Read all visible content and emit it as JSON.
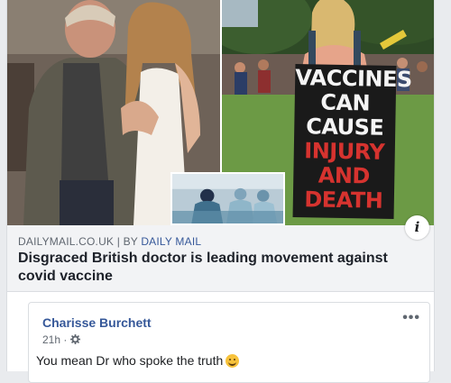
{
  "link_preview": {
    "sign_lines": [
      {
        "text": "VACCINES",
        "color": "#f4f4f4"
      },
      {
        "text": "CAN",
        "color": "#f4f4f4"
      },
      {
        "text": "CAUSE",
        "color": "#f4f4f4"
      },
      {
        "text": "INJURY",
        "color": "#d6332f"
      },
      {
        "text": "AND",
        "color": "#d6332f"
      },
      {
        "text": "DEATH",
        "color": "#d6332f"
      }
    ],
    "info_icon": "info-icon",
    "source_domain": "DAILYMAIL.CO.UK",
    "source_separator": "|",
    "source_by": "BY",
    "source_author": "DAILY MAIL",
    "headline": "Disgraced British doctor is leading movement against covid vaccine"
  },
  "comment": {
    "author": "Charisse Burchett",
    "more_label": "•••",
    "time": "21h",
    "meta_separator": "·",
    "privacy_icon": "gear-icon",
    "text": "You mean Dr who spoke the truth",
    "emoji": "smile-emoji"
  },
  "colors": {
    "link_blue": "#365899",
    "meta_gray": "#606770",
    "background": "#e9ebee"
  }
}
